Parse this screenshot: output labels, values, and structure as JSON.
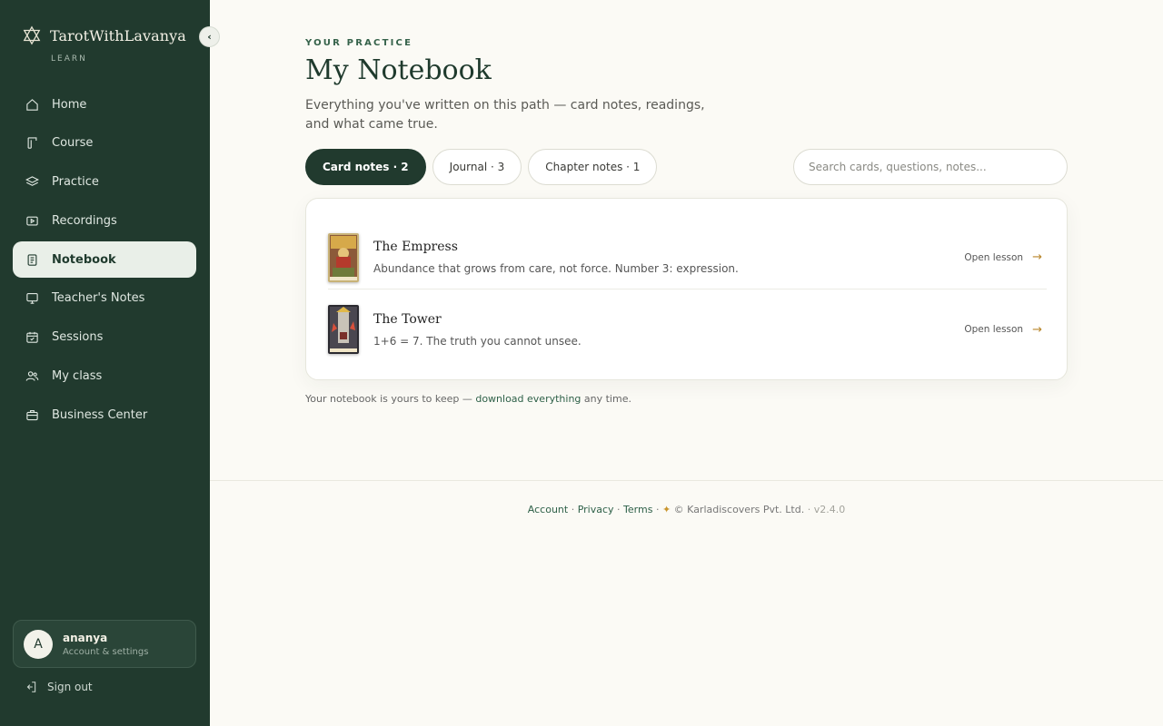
{
  "brand": {
    "name": "TarotWithLavanya",
    "sub": "LEARN"
  },
  "sidebar": {
    "items": [
      {
        "label": "Home",
        "icon": "home-icon"
      },
      {
        "label": "Course",
        "icon": "book-icon"
      },
      {
        "label": "Practice",
        "icon": "layers-icon"
      },
      {
        "label": "Recordings",
        "icon": "play-icon"
      },
      {
        "label": "Notebook",
        "icon": "notebook-icon",
        "active": true
      },
      {
        "label": "Teacher's Notes",
        "icon": "monitor-icon"
      },
      {
        "label": "Sessions",
        "icon": "calendar-icon"
      },
      {
        "label": "My class",
        "icon": "users-icon"
      },
      {
        "label": "Business Center",
        "icon": "briefcase-icon"
      }
    ]
  },
  "user": {
    "initial": "A",
    "name": "ananya",
    "sub": "Account & settings"
  },
  "signout": "Sign out",
  "header": {
    "eyebrow": "YOUR PRACTICE",
    "title": "My Notebook",
    "subtitle": "Everything you've written on this path — card notes, readings, and what came true."
  },
  "tabs": [
    {
      "label": "Card notes · 2",
      "active": true
    },
    {
      "label": "Journal · 3"
    },
    {
      "label": "Chapter notes · 1"
    }
  ],
  "search": {
    "placeholder": "Search cards, questions, notes..."
  },
  "notes": [
    {
      "title": "The Empress",
      "desc": "Abundance that grows from care, not force. Number 3: expression.",
      "action": "Open lesson",
      "arrow": "→"
    },
    {
      "title": "The Tower",
      "desc": "1+6 = 7. The truth you cannot unsee.",
      "action": "Open lesson",
      "arrow": "→"
    }
  ],
  "keep_note": {
    "before": "Your notebook is yours to keep — ",
    "link": "download everything",
    "after": " any time."
  },
  "footer": {
    "account": "Account",
    "privacy": "Privacy",
    "terms": "Terms",
    "sparkle": "✦",
    "copyright": "© Karladiscovers Pvt. Ltd.",
    "version": "v2.4.0"
  },
  "colors": {
    "sidebar": "#213a2e",
    "accent": "#2e6048",
    "gold": "#b8862b",
    "background": "#fbfaf5"
  }
}
